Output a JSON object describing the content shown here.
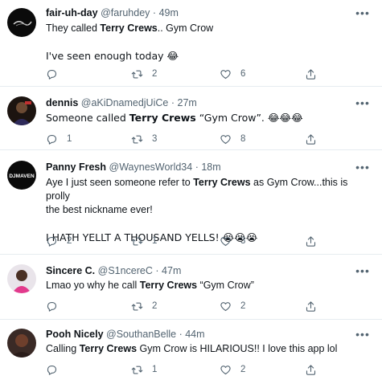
{
  "tweets": [
    {
      "name": "fair-uh-day",
      "handle": "@faruhdey",
      "sep": "·",
      "time": "49m",
      "line1_pre": "They called ",
      "line1_bold": "Terry Crews",
      "line1_post": ".. Gym Crow",
      "line2": "I've seen enough today 😂",
      "replies": "",
      "retweets": "2",
      "likes": "6"
    },
    {
      "name": "dennis",
      "handle": "@aKiDnamedjUiCe",
      "sep": "·",
      "time": "27m",
      "line1_pre": "Someone called ",
      "line1_bold": "Terry Crews",
      "line1_post": " “Gym Crow”. 😂😂😂",
      "replies": "1",
      "retweets": "3",
      "likes": "8"
    },
    {
      "name": "Panny Fresh",
      "handle": "@WaynesWorld34",
      "sep": "·",
      "time": "18m",
      "avatar_text": "DJMAVEN",
      "line1_pre": "Aye I just seen someone refer to ",
      "line1_bold": "Terry Crews",
      "line1_post": " as Gym Crow...this is prolly",
      "line1b": "the best nickname ever!",
      "line2": "I HATH YELLT A THOUSAND YELLS! 😭😭😭",
      "replies": "2",
      "retweets": "1",
      "likes": "3"
    },
    {
      "name": "Sincere C.",
      "handle": "@S1ncereC",
      "sep": "·",
      "time": "47m",
      "line1_pre": "Lmao yo why he call ",
      "line1_bold": "Terry Crews",
      "line1_post": " “Gym Crow”",
      "replies": "",
      "retweets": "2",
      "likes": "2"
    },
    {
      "name": "Pooh Nicely",
      "handle": "@SouthanBelle",
      "sep": "·",
      "time": "44m",
      "line1_pre": "Calling ",
      "line1_bold": "Terry Crews",
      "line1_post": " Gym Crow is HILARIOUS!! I love this app lol",
      "replies": "",
      "retweets": "1",
      "likes": "2"
    }
  ],
  "icons": {
    "reply": "reply-icon",
    "retweet": "retweet-icon",
    "like": "heart-icon",
    "share": "share-icon",
    "more": "more-icon"
  },
  "colors": {
    "text": "#0f1419",
    "secondary": "#536471",
    "divider": "#e6ecf0"
  }
}
